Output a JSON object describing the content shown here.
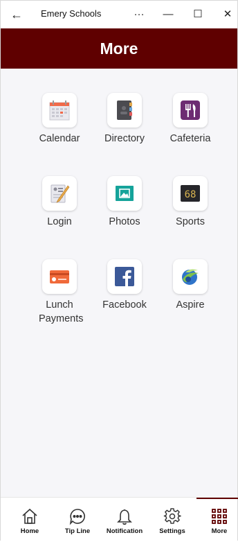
{
  "window": {
    "title": "Emery Schools",
    "back_icon": "←",
    "more_icon": "···",
    "minimize_icon": "—",
    "maximize_icon": "☐",
    "close_icon": "✕"
  },
  "header": {
    "title": "More"
  },
  "tiles": [
    {
      "label": "Calendar",
      "icon": "calendar-icon"
    },
    {
      "label": "Directory",
      "icon": "directory-icon"
    },
    {
      "label": "Cafeteria",
      "icon": "cafeteria-icon"
    },
    {
      "label": "Login",
      "icon": "login-icon"
    },
    {
      "label": "Photos",
      "icon": "photos-icon"
    },
    {
      "label": "Sports",
      "icon": "sports-icon"
    },
    {
      "label": "Lunch Payments",
      "icon": "lunch-payments-icon"
    },
    {
      "label": "Facebook",
      "icon": "facebook-icon"
    },
    {
      "label": "Aspire",
      "icon": "aspire-icon"
    }
  ],
  "sports_scoreboard_text": "68",
  "tabs": [
    {
      "label": "Home",
      "icon": "home-icon"
    },
    {
      "label": "Tip Line",
      "icon": "chat-icon"
    },
    {
      "label": "Notification",
      "icon": "bell-icon"
    },
    {
      "label": "Settings",
      "icon": "gear-icon"
    },
    {
      "label": "More",
      "icon": "grid-icon",
      "selected": true
    }
  ],
  "colors": {
    "brand": "#5f0000",
    "background": "#f6f6f9"
  }
}
